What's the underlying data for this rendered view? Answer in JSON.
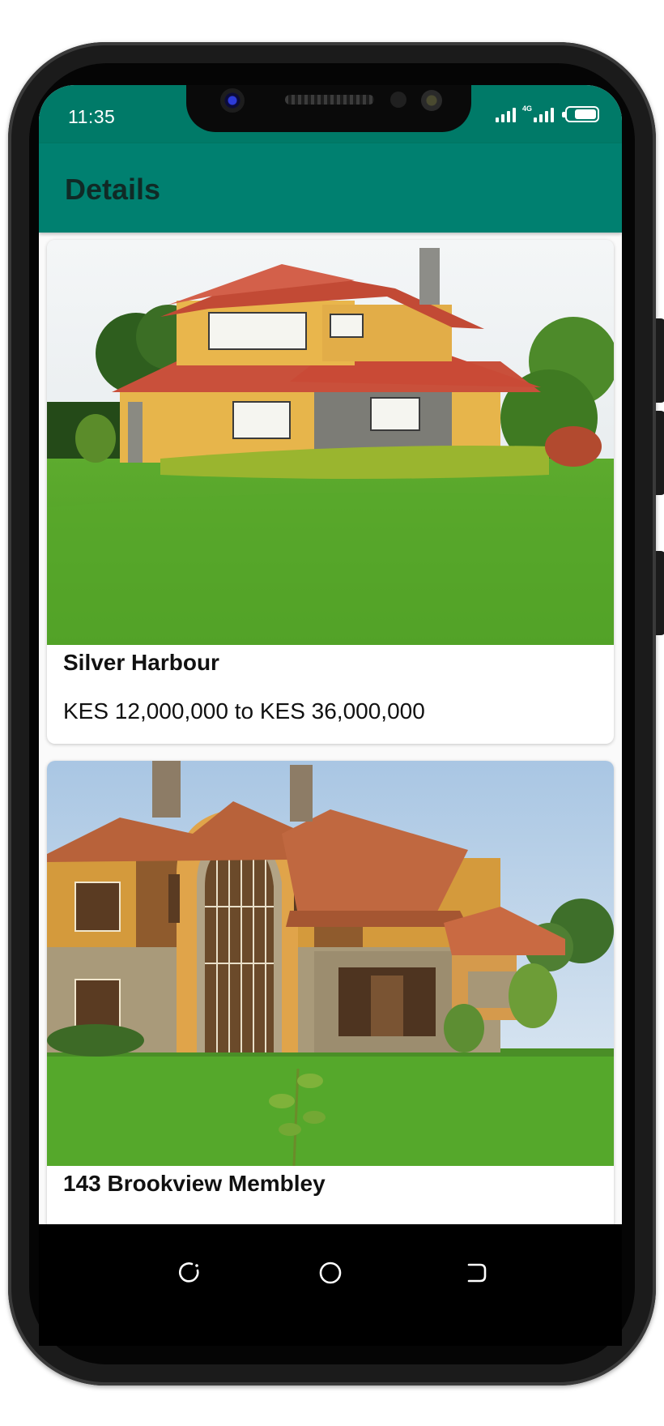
{
  "status_bar": {
    "time": "11:35",
    "network_label": "4G"
  },
  "app_bar": {
    "title": "Details"
  },
  "listings": [
    {
      "name": "Silver Harbour",
      "price": "KES 12,000,000 to KES 36,000,000",
      "image": "two-storey-house-yellow-walls-red-roof-green-lawn"
    },
    {
      "name": "143 Brookview Membley",
      "price": "",
      "image": "stone-and-orange-house-arched-window-green-lawn"
    }
  ],
  "nav": {
    "icons": [
      "back-icon",
      "home-icon",
      "recents-icon"
    ]
  },
  "colors": {
    "status_bar": "#007a68",
    "app_bar": "#008070",
    "title_text": "#102a26",
    "background": "#fafafa"
  }
}
